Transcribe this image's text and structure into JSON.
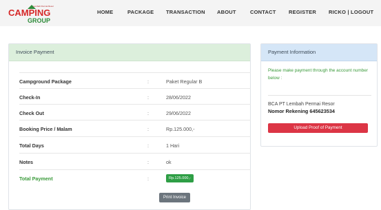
{
  "header": {
    "logo_small": "Lembah Permai Resor",
    "logo_main": "CAMPING",
    "logo_sub": "GROUP",
    "nav": [
      "HOME",
      "PACKAGE",
      "TRANSACTION",
      "ABOUT",
      "CONTACT",
      "REGISTER",
      "RICKO | LOGOUT"
    ]
  },
  "invoice": {
    "title": "Invoice Payment",
    "rows": [
      {
        "label": "Campground Package",
        "sep": ":",
        "value": "Paket Regular B"
      },
      {
        "label": "Check-In",
        "sep": ":",
        "value": "28/06/2022"
      },
      {
        "label": "Check Out",
        "sep": ":",
        "value": "29/06/2022"
      },
      {
        "label": "Booking Price / Malam",
        "sep": ":",
        "value": "Rp.125.000,-"
      },
      {
        "label": "Total Days",
        "sep": ":",
        "value": "1 Hari"
      },
      {
        "label": "Notes",
        "sep": ":",
        "value": "ok"
      }
    ],
    "total": {
      "label": "Total Payment",
      "sep": ":",
      "value": "Rp.125.000,-"
    },
    "print_label": "Print Invoice"
  },
  "payment": {
    "title": "Payment Information",
    "note": "Please make payment through the account number below :",
    "bank_name": "BCA PT Lembah Permai Resor",
    "account": "Nomor Rekening 645623534",
    "upload_label": "Upload Proof of Payment"
  },
  "colors": {
    "accent_green": "#2e9e45",
    "danger": "#dc3545",
    "print_gray": "#6c757d"
  }
}
